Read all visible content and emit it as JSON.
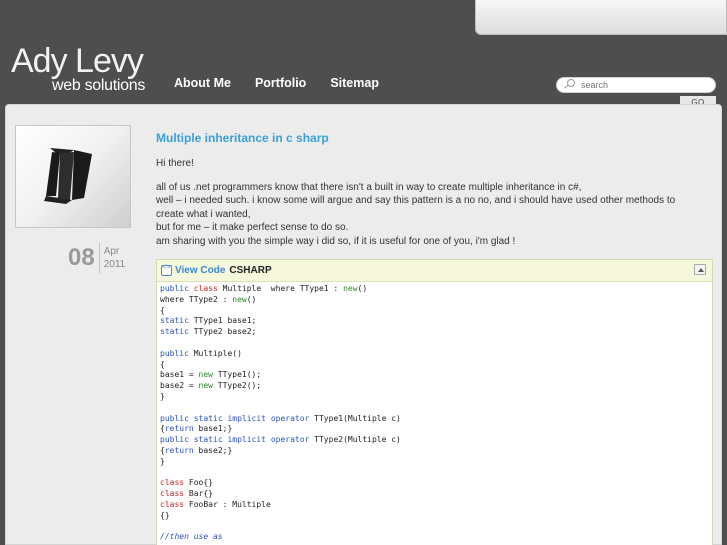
{
  "header": {
    "logo_main": "Ady Levy",
    "logo_sub": "web solutions",
    "nav": [
      "About Me",
      "Portfolio",
      "Sitemap"
    ],
    "search_placeholder": "search",
    "go_label": "GO"
  },
  "post": {
    "title": "Multiple inheritance in c sharp",
    "date_day": "08",
    "date_month": "Apr",
    "date_year": "2011",
    "greeting": "Hi there!",
    "paragraph_lines": [
      "all of us .net programmers know that there isn't a built in way to create multiple inheritance in c#,",
      "well – i needed such. i know some will argue and say this pattern is a no no, and i should have used other methods to create what i wanted,",
      "but for me – it make perfect sense to do so.",
      "am sharing with you the simple way i did so, if it is useful for one of you, i'm glad !"
    ]
  },
  "code_block": {
    "view_label": "View Code",
    "language": "CSHARP"
  },
  "colors": {
    "accent": "#3aa0d6",
    "header_bg": "#4e4e4e",
    "content_bg": "#ececec"
  }
}
